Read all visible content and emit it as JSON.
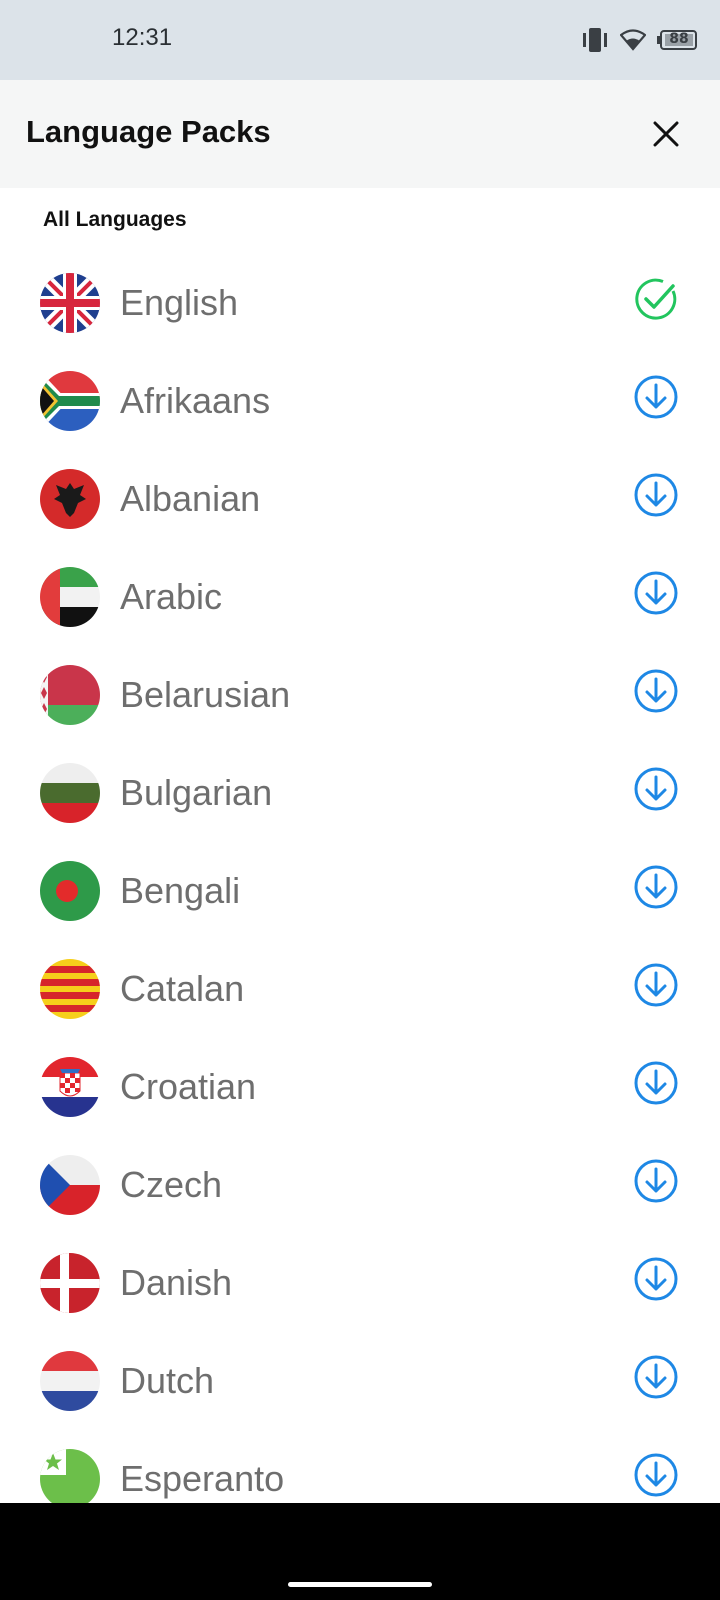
{
  "status_bar": {
    "time": "12:31",
    "battery_level": "88",
    "icons": [
      "vibrate-icon",
      "wifi-icon",
      "battery-icon"
    ]
  },
  "header": {
    "title": "Language Packs",
    "close_icon": "close-icon"
  },
  "section_title": "All Languages",
  "colors": {
    "installed": "#22c55e",
    "download": "#1e88e5",
    "language_text": "#6e6e6e",
    "header_bg": "#f5f6f6",
    "status_bg": "#dce3e9"
  },
  "languages": [
    {
      "name": "English",
      "flag": "uk-flag-icon",
      "status": "installed"
    },
    {
      "name": "Afrikaans",
      "flag": "south-africa-flag-icon",
      "status": "download"
    },
    {
      "name": "Albanian",
      "flag": "albania-flag-icon",
      "status": "download"
    },
    {
      "name": "Arabic",
      "flag": "uae-flag-icon",
      "status": "download"
    },
    {
      "name": "Belarusian",
      "flag": "belarus-flag-icon",
      "status": "download"
    },
    {
      "name": "Bulgarian",
      "flag": "bulgaria-flag-icon",
      "status": "download"
    },
    {
      "name": "Bengali",
      "flag": "bangladesh-flag-icon",
      "status": "download"
    },
    {
      "name": "Catalan",
      "flag": "catalonia-flag-icon",
      "status": "download"
    },
    {
      "name": "Croatian",
      "flag": "croatia-flag-icon",
      "status": "download"
    },
    {
      "name": "Czech",
      "flag": "czech-flag-icon",
      "status": "download"
    },
    {
      "name": "Danish",
      "flag": "denmark-flag-icon",
      "status": "download"
    },
    {
      "name": "Dutch",
      "flag": "netherlands-flag-icon",
      "status": "download"
    },
    {
      "name": "Esperanto",
      "flag": "esperanto-flag-icon",
      "status": "download"
    }
  ]
}
